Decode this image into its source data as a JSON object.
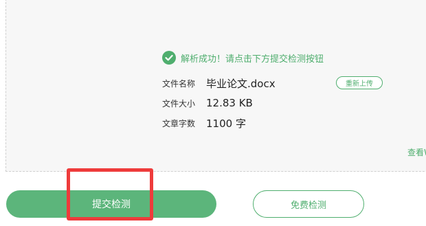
{
  "result": {
    "success_text": "解析成功！请点击下方提交检测按钮",
    "reupload_label": "重新上传",
    "view_link": "查看W"
  },
  "file_info": {
    "name_label": "文件名称",
    "name_value": "毕业论文.docx",
    "size_label": "文件大小",
    "size_value": "12.83 KB",
    "wordcount_label": "文章字数",
    "wordcount_value": "1100 字"
  },
  "actions": {
    "submit_label": "提交检测",
    "free_label": "免费检测"
  },
  "colors": {
    "accent": "#4fae6e",
    "submit_bg": "#5cb57b",
    "highlight": "#ee3b3b"
  }
}
